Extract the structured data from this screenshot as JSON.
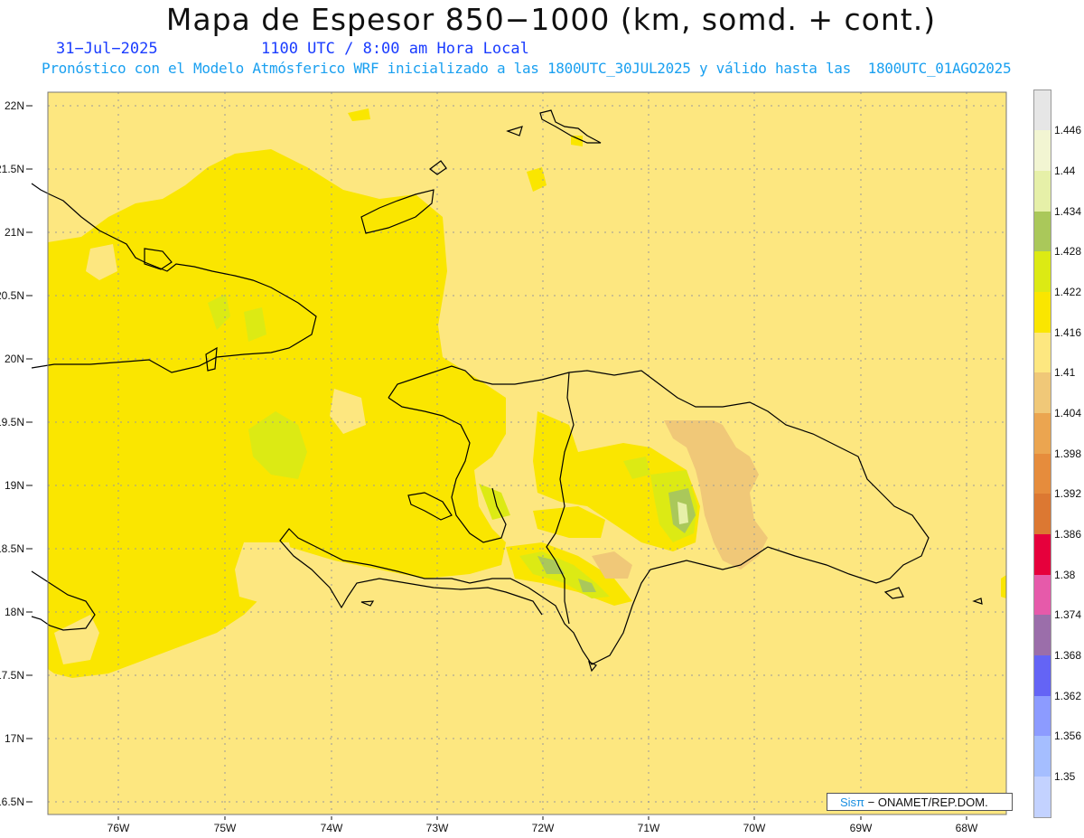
{
  "title": "Mapa de Espesor 850−1000 (km, somd. + cont.)",
  "date": "31−Jul−2025",
  "time": "1100 UTC / 8:00 am Hora Local",
  "model_line": "Pronóstico con el Modelo Atmósferico WRF inicializado a las 1800UTC_30JUL2025 y válido hasta las  1800UTC_01AGO2025",
  "lat_labels": [
    "22N",
    "21.5N",
    "21N",
    "20.5N",
    "20N",
    "19.5N",
    "19N",
    "18.5N",
    "18N",
    "17.5N",
    "17N",
    "16.5N"
  ],
  "lon_labels": [
    "76W",
    "75W",
    "74W",
    "73W",
    "72W",
    "71W",
    "70W",
    "69W",
    "68W"
  ],
  "colorbar": {
    "labels": [
      "1.446",
      "1.44",
      "1.434",
      "1.428",
      "1.422",
      "1.416",
      "1.41",
      "1.404",
      "1.398",
      "1.392",
      "1.386",
      "1.38",
      "1.374",
      "1.368",
      "1.362",
      "1.356",
      "1.35"
    ],
    "colors": [
      "#e6e6e6",
      "#f2f5d2",
      "#e6f0a8",
      "#aac85a",
      "#dcea14",
      "#fae600",
      "#fde780",
      "#f0c878",
      "#eba550",
      "#e68c3c",
      "#dc7832",
      "#e6003c",
      "#e65aaa",
      "#9b6eaa",
      "#6464f5",
      "#8c9bff",
      "#a5beff",
      "#c3d2ff"
    ]
  },
  "credit": {
    "brand": "Sisπ",
    "text": "− ONAMET/REP.DOM."
  },
  "field_colors": {
    "base": "#fde780",
    "yellow": "#fae600",
    "lime": "#dcea14",
    "green": "#aac85a",
    "tan": "#f0c878",
    "coast": "#000000",
    "grid": "#9a9a9a"
  }
}
